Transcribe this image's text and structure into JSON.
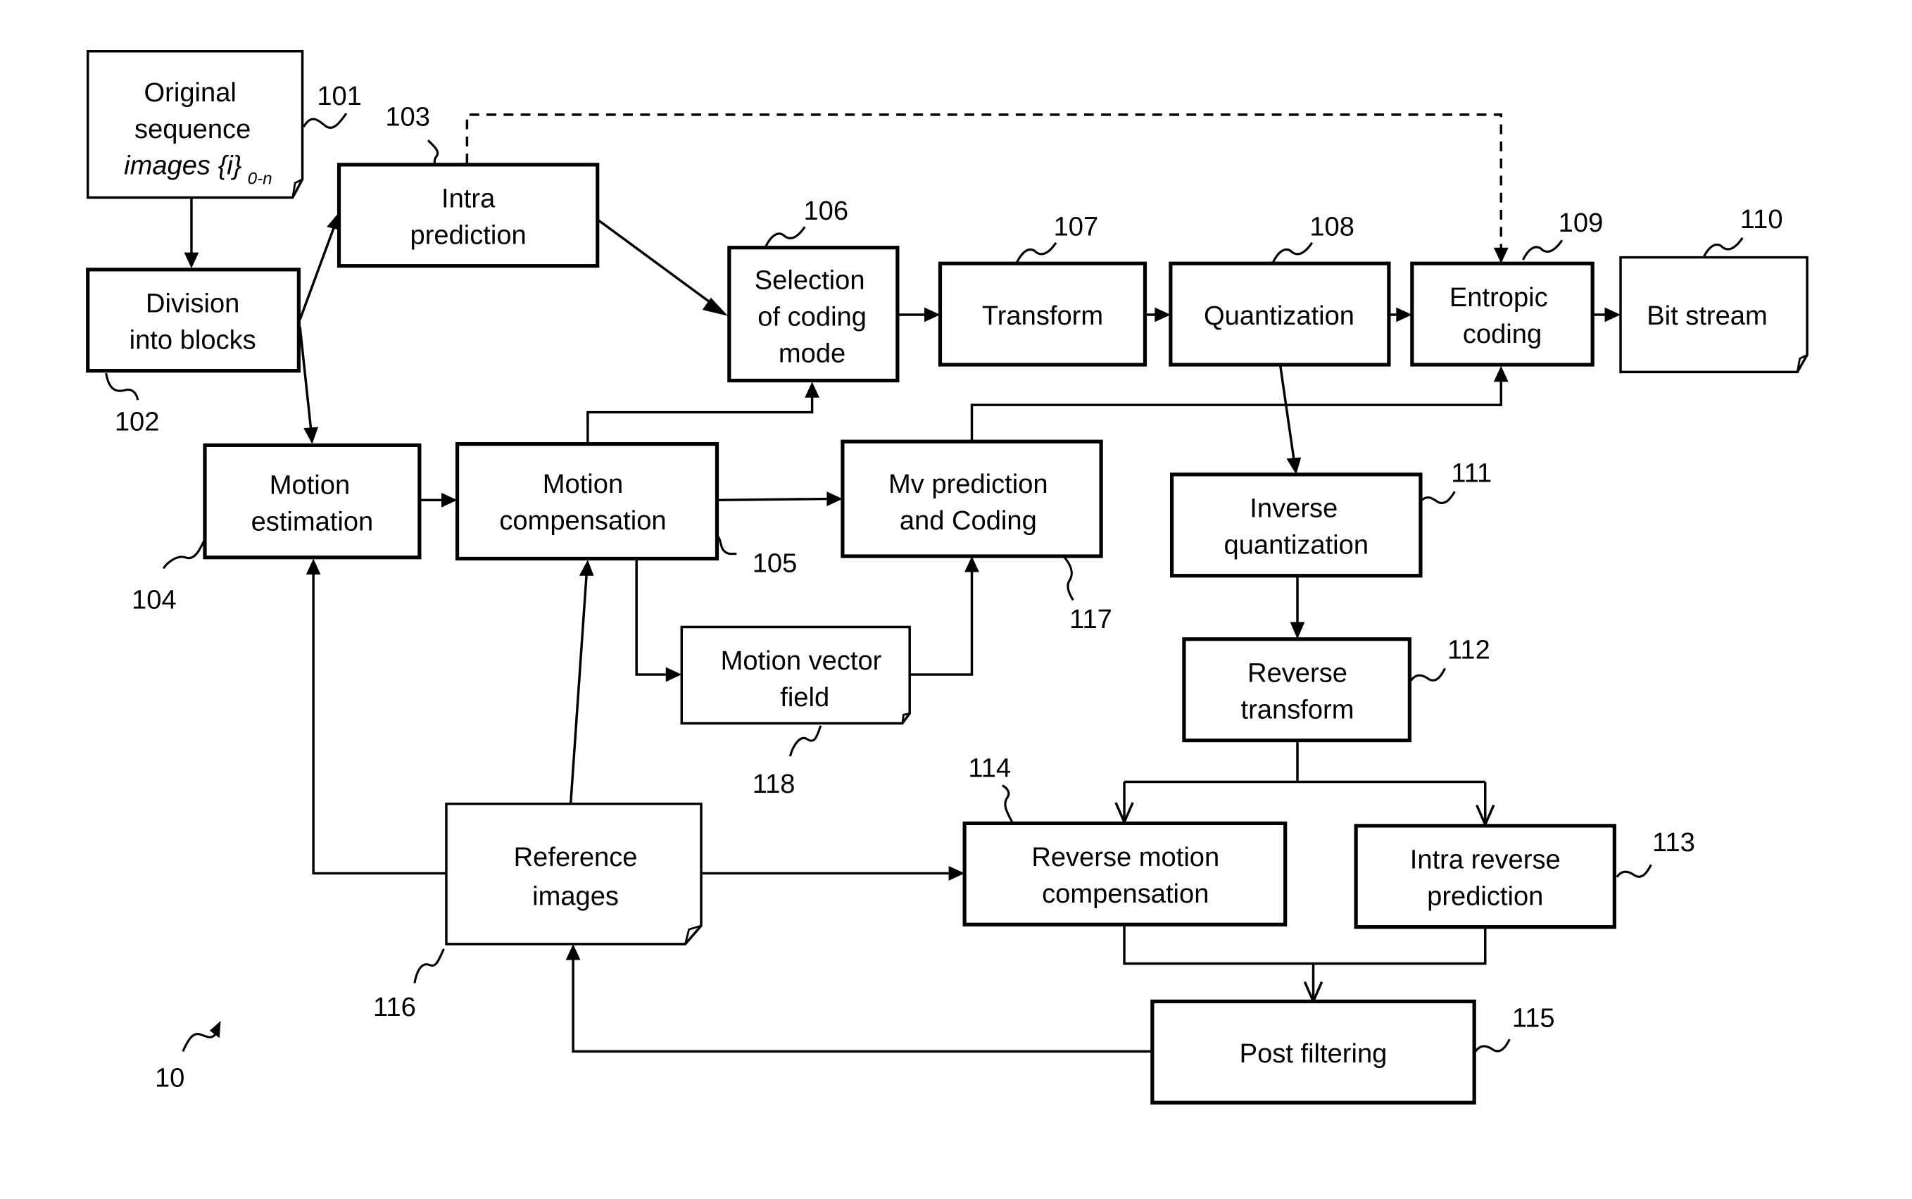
{
  "figure": {
    "figure_number": "10",
    "blocks": {
      "original_sequence": {
        "ref": "101",
        "lines": [
          "Original",
          "sequence"
        ],
        "italic_line": "images {i}",
        "subscript": "0-n"
      },
      "division": {
        "ref": "102",
        "lines": [
          "Division",
          "into blocks"
        ]
      },
      "intra_prediction": {
        "ref": "103",
        "lines": [
          "Intra",
          "prediction"
        ]
      },
      "motion_estimation": {
        "ref": "104",
        "lines": [
          "Motion",
          "estimation"
        ]
      },
      "motion_compensation": {
        "ref": "105",
        "lines": [
          "Motion",
          "compensation"
        ]
      },
      "selection_coding_mode": {
        "ref": "106",
        "lines": [
          "Selection",
          "of coding",
          "mode"
        ]
      },
      "transform": {
        "ref": "107",
        "lines": [
          "Transform"
        ]
      },
      "quantization": {
        "ref": "108",
        "lines": [
          "Quantization"
        ]
      },
      "entropic_coding": {
        "ref": "109",
        "lines": [
          "Entropic",
          "coding"
        ]
      },
      "bit_stream": {
        "ref": "110",
        "lines": [
          "Bit stream"
        ]
      },
      "inverse_quantization": {
        "ref": "111",
        "lines": [
          "Inverse",
          "quantization"
        ]
      },
      "reverse_transform": {
        "ref": "112",
        "lines": [
          "Reverse",
          "transform"
        ]
      },
      "intra_reverse_prediction": {
        "ref": "113",
        "lines": [
          "Intra reverse",
          "prediction"
        ]
      },
      "reverse_motion_compensation": {
        "ref": "114",
        "lines": [
          "Reverse motion",
          "compensation"
        ]
      },
      "post_filtering": {
        "ref": "115",
        "lines": [
          "Post filtering"
        ]
      },
      "reference_images": {
        "ref": "116",
        "lines": [
          "Reference",
          "images"
        ]
      },
      "mv_prediction_coding": {
        "ref": "117",
        "lines": [
          "Mv prediction",
          "and Coding"
        ]
      },
      "motion_vector_field": {
        "ref": "118",
        "lines": [
          "Motion vector",
          "field"
        ]
      }
    },
    "connections": [
      {
        "from": "original_sequence",
        "to": "division",
        "style": "solid"
      },
      {
        "from": "division",
        "to": "intra_prediction",
        "style": "solid"
      },
      {
        "from": "division",
        "to": "motion_estimation",
        "style": "solid"
      },
      {
        "from": "intra_prediction",
        "to": "selection_coding_mode",
        "style": "solid"
      },
      {
        "from": "intra_prediction",
        "to": "entropic_coding",
        "style": "dashed"
      },
      {
        "from": "motion_estimation",
        "to": "motion_compensation",
        "style": "solid"
      },
      {
        "from": "motion_compensation",
        "to": "selection_coding_mode",
        "style": "solid"
      },
      {
        "from": "motion_compensation",
        "to": "mv_prediction_coding",
        "style": "solid"
      },
      {
        "from": "motion_compensation",
        "to": "motion_vector_field",
        "style": "solid"
      },
      {
        "from": "motion_vector_field",
        "to": "mv_prediction_coding",
        "style": "solid"
      },
      {
        "from": "mv_prediction_coding",
        "to": "entropic_coding",
        "style": "solid"
      },
      {
        "from": "selection_coding_mode",
        "to": "transform",
        "style": "solid"
      },
      {
        "from": "transform",
        "to": "quantization",
        "style": "solid"
      },
      {
        "from": "quantization",
        "to": "entropic_coding",
        "style": "solid"
      },
      {
        "from": "entropic_coding",
        "to": "bit_stream",
        "style": "solid"
      },
      {
        "from": "quantization",
        "to": "inverse_quantization",
        "style": "solid"
      },
      {
        "from": "inverse_quantization",
        "to": "reverse_transform",
        "style": "solid"
      },
      {
        "from": "reverse_transform",
        "to": "reverse_motion_compensation",
        "style": "solid"
      },
      {
        "from": "reverse_transform",
        "to": "intra_reverse_prediction",
        "style": "solid"
      },
      {
        "from": "reference_images",
        "to": "reverse_motion_compensation",
        "style": "solid"
      },
      {
        "from": "reverse_motion_compensation",
        "to": "post_filtering",
        "style": "solid"
      },
      {
        "from": "intra_reverse_prediction",
        "to": "post_filtering",
        "style": "solid"
      },
      {
        "from": "post_filtering",
        "to": "reference_images",
        "style": "solid"
      },
      {
        "from": "reference_images",
        "to": "motion_estimation",
        "style": "solid"
      },
      {
        "from": "reference_images",
        "to": "motion_compensation",
        "style": "solid"
      }
    ]
  }
}
